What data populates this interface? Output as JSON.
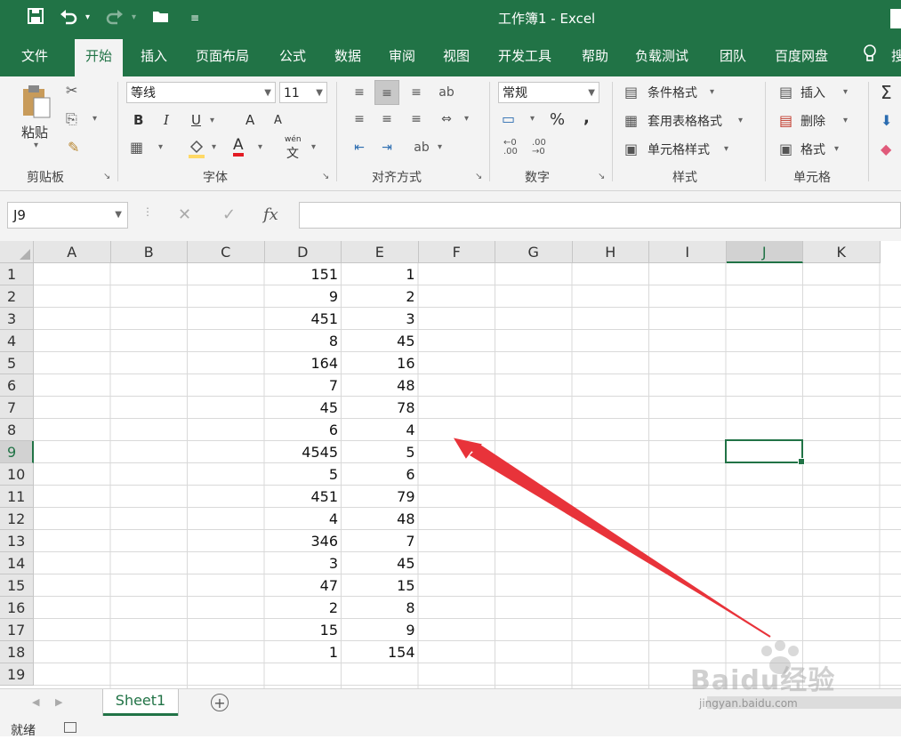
{
  "window": {
    "title": "工作簿1  -  Excel"
  },
  "qat": {
    "save_icon": "save-icon",
    "undo_icon": "undo-icon",
    "redo_icon": "redo-icon",
    "open_icon": "folder-icon"
  },
  "tabs": [
    {
      "label": "文件"
    },
    {
      "label": "开始"
    },
    {
      "label": "插入"
    },
    {
      "label": "页面布局"
    },
    {
      "label": "公式"
    },
    {
      "label": "数据"
    },
    {
      "label": "审阅"
    },
    {
      "label": "视图"
    },
    {
      "label": "开发工具"
    },
    {
      "label": "帮助"
    },
    {
      "label": "负载测试"
    },
    {
      "label": "团队"
    },
    {
      "label": "百度网盘"
    },
    {
      "label": "搜"
    }
  ],
  "ribbon": {
    "clipboard": {
      "paste": "粘贴",
      "label": "剪贴板"
    },
    "font": {
      "name": "等线",
      "size": "11",
      "bold": "B",
      "italic": "I",
      "underline": "U",
      "grow": "A",
      "shrink": "A",
      "color": "A",
      "phonetic": "wén",
      "phonetic_char": "文",
      "label": "字体"
    },
    "alignment": {
      "label": "对齐方式"
    },
    "number": {
      "format": "常规",
      "percent": "%",
      "comma": ",",
      "label": "数字"
    },
    "styles": {
      "conditional": "条件格式",
      "table": "套用表格格式",
      "cell": "单元格样式",
      "label": "样式"
    },
    "cells": {
      "insert": "插入",
      "delete": "删除",
      "format": "格式",
      "label": "单元格"
    },
    "editing": {
      "sum": "Σ"
    }
  },
  "formula_bar": {
    "name_box": "J9",
    "cancel": "✕",
    "enter": "✓",
    "fx": "fx",
    "value": ""
  },
  "columns": [
    "A",
    "B",
    "C",
    "D",
    "E",
    "F",
    "G",
    "H",
    "I",
    "J",
    "K"
  ],
  "rows": [
    "1",
    "2",
    "3",
    "4",
    "5",
    "6",
    "7",
    "8",
    "9",
    "10",
    "11",
    "12",
    "13",
    "14",
    "15",
    "16",
    "17",
    "18",
    "19"
  ],
  "data": {
    "D": [
      "151",
      "9",
      "451",
      "8",
      "164",
      "7",
      "45",
      "6",
      "4545",
      "5",
      "451",
      "4",
      "346",
      "3",
      "47",
      "2",
      "15",
      "1"
    ],
    "E": [
      "1",
      "2",
      "3",
      "45",
      "16",
      "48",
      "78",
      "4",
      "5",
      "6",
      "79",
      "48",
      "7",
      "45",
      "15",
      "8",
      "9",
      "154"
    ]
  },
  "selection": {
    "cell": "J9",
    "column": "J",
    "row": "9"
  },
  "sheets": [
    {
      "name": "Sheet1"
    }
  ],
  "status": {
    "text": "就绪"
  },
  "watermark": {
    "brand": "Baidu经验",
    "url": "jingyan.baidu.com"
  },
  "colors": {
    "excel_green": "#217346",
    "arrow_red": "#e8333a"
  }
}
